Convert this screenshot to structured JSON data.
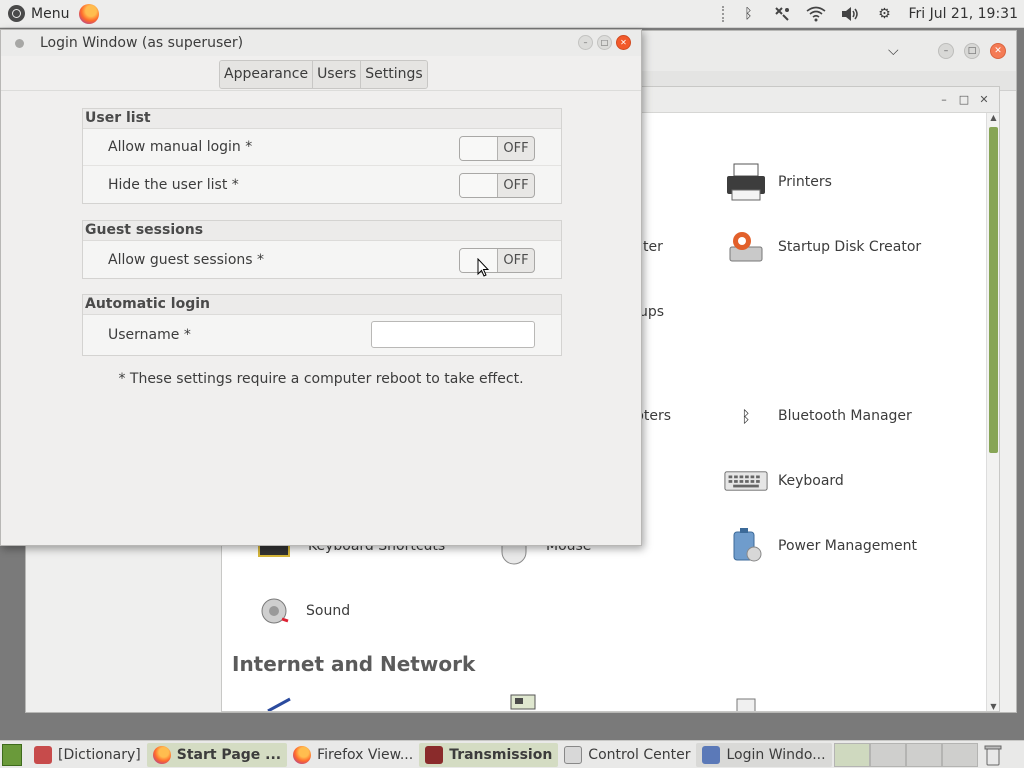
{
  "top_panel": {
    "menu_label": "Menu",
    "clock": "Fri Jul 21, 19:31",
    "icons": [
      "ubuntu-logo-icon",
      "firefox-icon",
      "bluetooth-icon",
      "network-icon",
      "wifi-icon",
      "volume-icon",
      "settings-icon"
    ]
  },
  "control_center": {
    "items": {
      "printers": "Printers",
      "startup_disk_creator": "Startup Disk Creator",
      "bluetooth_manager": "Bluetooth Manager",
      "keyboard": "Keyboard",
      "power_management": "Power Management",
      "keyboard_shortcuts": "Keyboard Shortcuts",
      "mouse": "Mouse",
      "sound": "Sound"
    },
    "fragments": {
      "frag_center": "ter",
      "frag_backups": "ups",
      "frag_adapters": "pters"
    },
    "section_heading": "Internet and Network"
  },
  "login_window": {
    "title": "Login Window (as superuser)",
    "tabs": [
      "Appearance",
      "Users",
      "Settings"
    ],
    "groups": {
      "user_list": {
        "title": "User list",
        "allow_manual_login": "Allow manual login *",
        "hide_user_list": "Hide the user list *"
      },
      "guest_sessions": {
        "title": "Guest sessions",
        "allow_guest_sessions": "Allow guest sessions *"
      },
      "automatic_login": {
        "title": "Automatic login",
        "username_label": "Username *",
        "username_value": ""
      }
    },
    "switch_state": "OFF",
    "note": "* These settings require a computer reboot to take effect."
  },
  "taskbar": {
    "items": [
      "[Dictionary]",
      "Start Page ...",
      "Firefox View...",
      "Transmission",
      "Control Center",
      "Login Windo..."
    ]
  }
}
